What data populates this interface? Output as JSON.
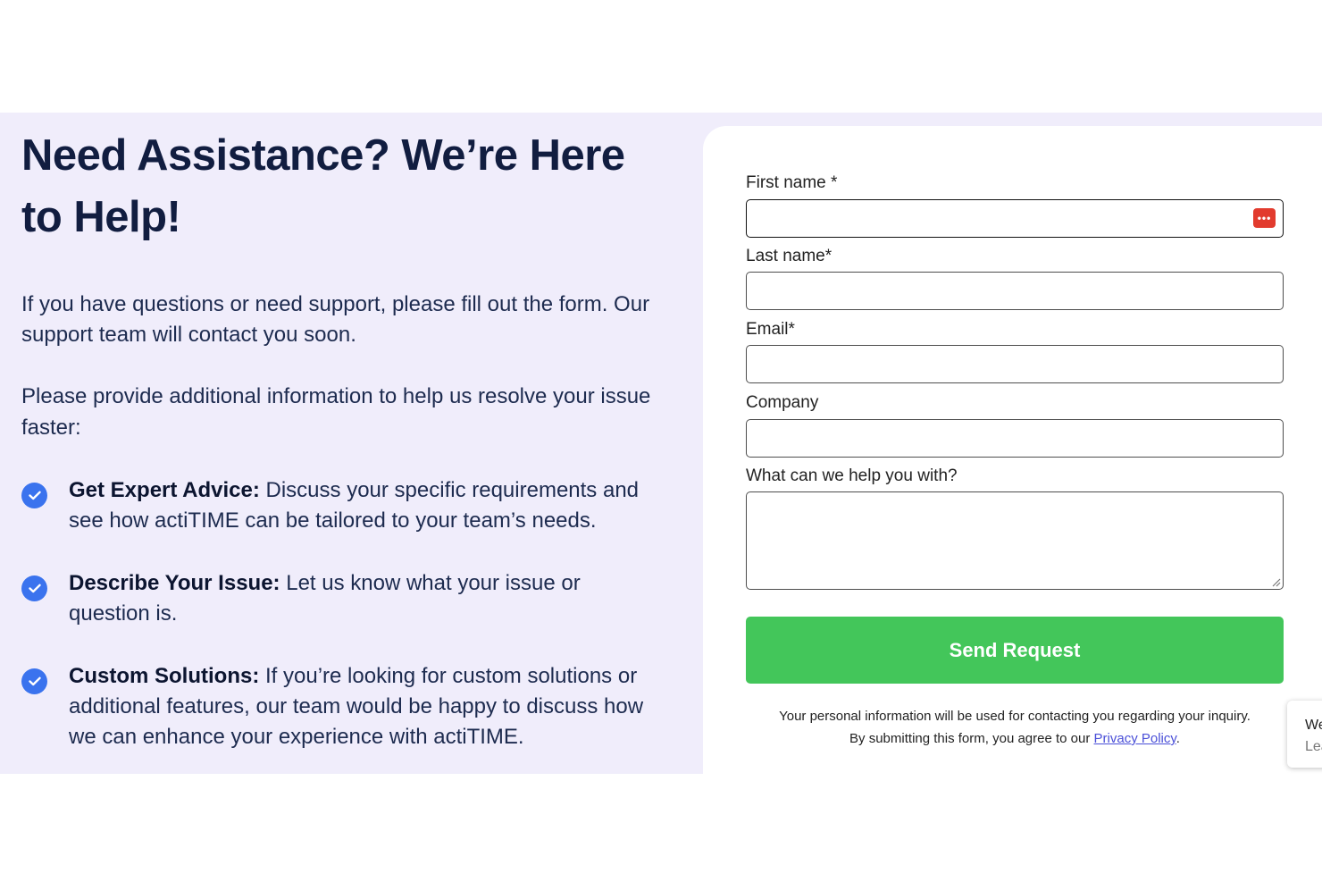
{
  "headline": "Need Assistance? We’re Here to Help!",
  "intro": "If you have questions or need support, please fill out the form. Our support team will contact you soon.",
  "intro2": "Please provide additional information to help us resolve your issue faster:",
  "points": [
    {
      "title": "Get Expert Advice:",
      "text": " Discuss your specific requirements and see how actiTIME can be tailored to your team’s needs."
    },
    {
      "title": "Describe Your Issue:",
      "text": " Let us know what your issue or question is."
    },
    {
      "title": "Custom Solutions:",
      "text": " If you’re looking for custom solutions or additional features, our team would be happy to discuss how we can enhance your experience with actiTIME."
    }
  ],
  "form": {
    "first_name_label": "First name *",
    "last_name_label": "Last name*",
    "email_label": "Email*",
    "company_label": "Company",
    "help_label": "What can we help you with?",
    "first_name_value": "",
    "last_name_value": "",
    "email_value": "",
    "company_value": "",
    "help_value": "",
    "password_manager_icon": "•••",
    "submit_label": "Send Request",
    "notice_line1": "Your personal information will be used for contacting you regarding your inquiry.",
    "notice_line2_prefix": "By submitting this form, you agree to our ",
    "privacy_link": "Privacy Policy",
    "notice_line2_suffix": "."
  },
  "side_widget": {
    "line1": "We",
    "line2": "Lea"
  },
  "colors": {
    "band_bg": "#f0edfb",
    "headline": "#111d40",
    "check": "#3a73ee",
    "submit": "#43c65a",
    "link": "#4a4fd8"
  }
}
